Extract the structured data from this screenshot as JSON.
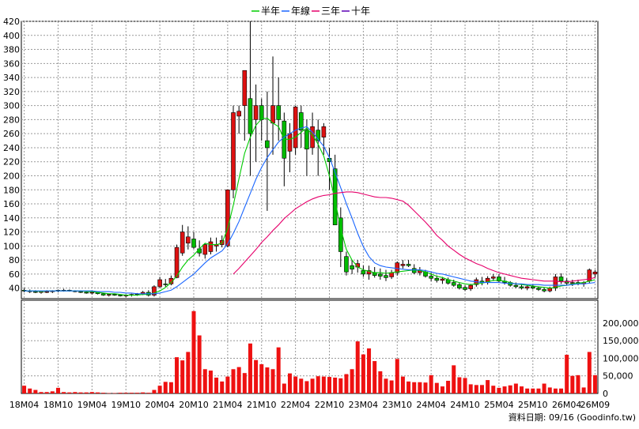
{
  "legend": [
    {
      "label": "半年",
      "color": "#00cc00"
    },
    {
      "label": "年線",
      "color": "#1a66ff"
    },
    {
      "label": "三年",
      "color": "#e6006b"
    },
    {
      "label": "十年",
      "color": "#5a00b4"
    }
  ],
  "source_label": "資料日期: 09/16  (Goodinfo.tw)",
  "colors": {
    "up": "#dd1111",
    "down": "#00bb00",
    "volume": "#ee1111",
    "grid": "#999999",
    "axis": "#000000"
  },
  "chart_data": {
    "type": "candlestick",
    "categories": [
      "18M04",
      "18M05",
      "18M06",
      "18M07",
      "18M08",
      "18M09",
      "18M10",
      "18M11",
      "18M12",
      "19M01",
      "19M02",
      "19M03",
      "19M04",
      "19M05",
      "19M06",
      "19M07",
      "19M08",
      "19M09",
      "19M10",
      "19M11",
      "19M12",
      "20M01",
      "20M02",
      "20M03",
      "20M04",
      "20M05",
      "20M06",
      "20M07",
      "20M08",
      "20M09",
      "20M10",
      "20M11",
      "20M12",
      "21M01",
      "21M02",
      "21M03",
      "21M04",
      "21M05",
      "21M06",
      "21M07",
      "21M08",
      "21M09",
      "21M10",
      "21M11",
      "21M12",
      "22M01",
      "22M02",
      "22M03",
      "22M04",
      "22M05",
      "22M06",
      "22M07",
      "22M08",
      "22M09",
      "22M10",
      "22M11",
      "22M12",
      "23M01",
      "23M02",
      "23M03",
      "23M04",
      "23M05",
      "23M06",
      "23M07",
      "23M08",
      "23M09",
      "23M10",
      "23M11",
      "23M12",
      "24M01",
      "24M02",
      "24M03",
      "24M04",
      "24M05",
      "24M06",
      "24M07",
      "24M08",
      "24M09",
      "24M10",
      "24M11",
      "24M12",
      "25M01",
      "25M02",
      "25M03",
      "25M04",
      "25M05",
      "25M06",
      "25M07",
      "25M08",
      "25M09",
      "25M10",
      "25M11",
      "25M12",
      "26M01",
      "26M02",
      "26M03",
      "26M04",
      "26M05",
      "26M06",
      "26M07",
      "26M08",
      "26M09"
    ],
    "x_tick_labels": [
      "18M04",
      "18M10",
      "19M04",
      "19M10",
      "20M04",
      "20M10",
      "21M04",
      "21M10",
      "22M04",
      "22M10",
      "23M04",
      "23M10",
      "24M04",
      "24M10",
      "25M04",
      "25M10",
      "26M04",
      "26M09"
    ],
    "price_axis": {
      "ylim": [
        25,
        420
      ],
      "ticks": [
        40,
        60,
        80,
        100,
        120,
        140,
        160,
        180,
        200,
        220,
        240,
        260,
        280,
        300,
        320,
        340,
        360,
        380,
        400,
        420
      ]
    },
    "volume_axis": {
      "ylim": [
        0,
        265000
      ],
      "ticks": [
        0,
        50000,
        100000,
        150000,
        200000
      ],
      "tick_labels": [
        "0",
        "50,000",
        "100,000",
        "150,000",
        "200,000"
      ]
    },
    "ohlc": [
      [
        37,
        40,
        34,
        36
      ],
      [
        36,
        38,
        33,
        35
      ],
      [
        35,
        37,
        33,
        34
      ],
      [
        34,
        36,
        32,
        35
      ],
      [
        35,
        37,
        33,
        35
      ],
      [
        35,
        37,
        33,
        36
      ],
      [
        36,
        38,
        34,
        37
      ],
      [
        37,
        39,
        35,
        37
      ],
      [
        37,
        38,
        35,
        36
      ],
      [
        36,
        37,
        34,
        35
      ],
      [
        35,
        36,
        33,
        34
      ],
      [
        34,
        35,
        32,
        33
      ],
      [
        33,
        35,
        31,
        34
      ],
      [
        34,
        35,
        31,
        32
      ],
      [
        32,
        33,
        29,
        30
      ],
      [
        30,
        32,
        28,
        31
      ],
      [
        31,
        32,
        29,
        30
      ],
      [
        30,
        31,
        28,
        29
      ],
      [
        29,
        31,
        27,
        30
      ],
      [
        30,
        32,
        28,
        31
      ],
      [
        31,
        33,
        29,
        32
      ],
      [
        32,
        36,
        30,
        34
      ],
      [
        34,
        37,
        28,
        30
      ],
      [
        30,
        44,
        28,
        42
      ],
      [
        42,
        56,
        40,
        52
      ],
      [
        46,
        53,
        42,
        45
      ],
      [
        46,
        58,
        44,
        54
      ],
      [
        55,
        102,
        54,
        98
      ],
      [
        90,
        130,
        86,
        120
      ],
      [
        104,
        128,
        95,
        113
      ],
      [
        110,
        120,
        96,
        98
      ],
      [
        96,
        108,
        85,
        90
      ],
      [
        88,
        104,
        82,
        102
      ],
      [
        92,
        112,
        88,
        106
      ],
      [
        100,
        112,
        92,
        102
      ],
      [
        102,
        115,
        98,
        108
      ],
      [
        100,
        164,
        98,
        180
      ],
      [
        180,
        300,
        168,
        290
      ],
      [
        285,
        300,
        260,
        292
      ],
      [
        300,
        350,
        250,
        350
      ],
      [
        310,
        420,
        200,
        260
      ],
      [
        280,
        330,
        220,
        300
      ],
      [
        300,
        310,
        250,
        280
      ],
      [
        250,
        320,
        150,
        240
      ],
      [
        275,
        370,
        230,
        300
      ],
      [
        300,
        340,
        250,
        280
      ],
      [
        278,
        290,
        185,
        225
      ],
      [
        235,
        275,
        205,
        260
      ],
      [
        240,
        300,
        230,
        298
      ],
      [
        290,
        300,
        240,
        265
      ],
      [
        265,
        280,
        200,
        238
      ],
      [
        240,
        290,
        230,
        270
      ],
      [
        265,
        280,
        200,
        250
      ],
      [
        255,
        275,
        230,
        270
      ],
      [
        225,
        240,
        180,
        220
      ],
      [
        210,
        230,
        140,
        130
      ],
      [
        140,
        155,
        70,
        92
      ],
      [
        85,
        92,
        58,
        63
      ],
      [
        72,
        80,
        60,
        67
      ],
      [
        70,
        80,
        62,
        75
      ],
      [
        65,
        72,
        56,
        60
      ],
      [
        60,
        72,
        52,
        65
      ],
      [
        62,
        70,
        55,
        58
      ],
      [
        60,
        68,
        52,
        57
      ],
      [
        58,
        66,
        50,
        55
      ],
      [
        56,
        66,
        53,
        62
      ],
      [
        62,
        78,
        58,
        76
      ],
      [
        72,
        80,
        68,
        74
      ],
      [
        74,
        80,
        70,
        72
      ],
      [
        68,
        74,
        60,
        62
      ],
      [
        62,
        70,
        58,
        65
      ],
      [
        63,
        66,
        55,
        57
      ],
      [
        57,
        62,
        50,
        54
      ],
      [
        54,
        58,
        48,
        51
      ],
      [
        51,
        56,
        46,
        53
      ],
      [
        52,
        55,
        45,
        47
      ],
      [
        48,
        52,
        42,
        44
      ],
      [
        45,
        48,
        38,
        40
      ],
      [
        41,
        44,
        36,
        38
      ],
      [
        39,
        46,
        36,
        44
      ],
      [
        45,
        55,
        42,
        52
      ],
      [
        50,
        56,
        44,
        48
      ],
      [
        48,
        57,
        45,
        54
      ],
      [
        54,
        60,
        50,
        56
      ],
      [
        56,
        60,
        48,
        50
      ],
      [
        50,
        56,
        45,
        48
      ],
      [
        48,
        50,
        42,
        44
      ],
      [
        44,
        48,
        40,
        42
      ],
      [
        42,
        46,
        38,
        40
      ],
      [
        40,
        45,
        37,
        42
      ],
      [
        42,
        45,
        38,
        40
      ],
      [
        40,
        42,
        36,
        38
      ],
      [
        38,
        41,
        34,
        36
      ],
      [
        36,
        42,
        34,
        40
      ],
      [
        40,
        60,
        36,
        56
      ],
      [
        56,
        61,
        46,
        50
      ],
      [
        50,
        54,
        44,
        47
      ],
      [
        47,
        52,
        43,
        48
      ],
      [
        48,
        52,
        44,
        46
      ],
      [
        46,
        50,
        42,
        48
      ],
      [
        50,
        68,
        47,
        66
      ],
      [
        60,
        66,
        55,
        63
      ]
    ],
    "volume": [
      22000,
      14000,
      10000,
      4000,
      4000,
      6000,
      16000,
      4000,
      3000,
      4000,
      3000,
      3000,
      4000,
      3000,
      2000,
      1000,
      1000,
      2000,
      2000,
      2000,
      2000,
      3000,
      2000,
      10000,
      22000,
      33000,
      32000,
      103000,
      94000,
      118000,
      234000,
      165000,
      69000,
      65000,
      45000,
      34000,
      48000,
      69000,
      75000,
      58000,
      142000,
      95000,
      83000,
      74000,
      69000,
      131000,
      28000,
      57000,
      48000,
      42000,
      35000,
      42000,
      49000,
      48000,
      47000,
      45000,
      43000,
      55000,
      69000,
      148000,
      111000,
      128000,
      92000,
      63000,
      42000,
      37000,
      98000,
      48000,
      34000,
      32000,
      32000,
      31000,
      52000,
      30000,
      20000,
      36000,
      80000,
      46000,
      44000,
      26000,
      24000,
      24000,
      38000,
      22000,
      16000,
      20000,
      23000,
      28000,
      20000,
      14000,
      14000,
      14000,
      28000,
      17000,
      14000,
      14000,
      110000,
      50000,
      52000,
      17000,
      118000,
      52000
    ],
    "series": [
      {
        "name": "半年",
        "values": [
          36,
          36,
          36,
          35,
          36,
          36,
          36,
          36,
          36,
          36,
          36,
          35,
          35,
          34,
          33,
          32,
          32,
          31,
          30,
          30,
          30,
          31,
          31,
          33,
          36,
          41,
          48,
          57,
          70,
          80,
          87,
          96,
          104,
          102,
          102,
          104,
          125,
          158,
          196,
          232,
          255,
          272,
          281,
          282,
          275,
          270,
          252,
          252,
          255,
          262,
          268,
          258,
          245,
          228,
          200,
          165,
          125,
          95,
          80,
          70,
          66,
          64,
          62,
          62,
          61,
          62,
          63,
          64,
          65,
          66,
          65,
          63,
          60,
          57,
          55,
          52,
          50,
          48,
          46,
          45,
          46,
          47,
          49,
          51,
          51,
          50,
          48,
          46,
          45,
          44,
          43,
          42,
          41,
          40,
          41,
          43,
          44,
          46,
          47,
          48,
          50,
          52
        ]
      },
      {
        "name": "年線",
        "values": [
          36,
          36,
          36,
          36,
          36,
          36,
          36,
          36,
          36,
          36,
          36,
          36,
          36,
          35,
          35,
          35,
          34,
          34,
          33,
          33,
          32,
          32,
          32,
          32,
          33,
          35,
          37,
          42,
          48,
          54,
          60,
          68,
          76,
          83,
          88,
          93,
          103,
          118,
          135,
          155,
          175,
          195,
          212,
          226,
          237,
          248,
          255,
          260,
          265,
          268,
          270,
          262,
          252,
          242,
          226,
          205,
          183,
          160,
          140,
          118,
          99,
          85,
          76,
          72,
          70,
          69,
          68,
          67,
          66,
          66,
          66,
          65,
          63,
          61,
          60,
          58,
          56,
          54,
          52,
          50,
          49,
          48,
          48,
          48,
          48,
          47,
          47,
          46,
          46,
          45,
          45,
          45,
          44,
          44,
          44,
          44,
          44,
          45,
          46,
          46,
          47,
          48
        ]
      },
      {
        "name": "三年",
        "values": [
          null,
          null,
          null,
          null,
          null,
          null,
          null,
          null,
          null,
          null,
          null,
          null,
          null,
          null,
          null,
          null,
          null,
          null,
          null,
          null,
          null,
          null,
          null,
          null,
          null,
          null,
          null,
          null,
          null,
          null,
          null,
          null,
          null,
          null,
          null,
          null,
          null,
          60,
          68,
          77,
          86,
          95,
          105,
          113,
          122,
          130,
          139,
          146,
          153,
          158,
          163,
          167,
          170,
          172,
          173,
          175,
          176,
          177,
          177,
          176,
          174,
          172,
          170,
          169,
          169,
          168,
          166,
          164,
          158,
          150,
          142,
          134,
          125,
          115,
          108,
          100,
          94,
          88,
          83,
          79,
          75,
          72,
          68,
          65,
          62,
          60,
          58,
          56,
          54,
          53,
          52,
          51,
          50,
          50,
          50,
          49,
          49,
          50,
          51,
          52,
          53,
          55
        ]
      },
      {
        "name": "十年",
        "values": []
      }
    ]
  }
}
